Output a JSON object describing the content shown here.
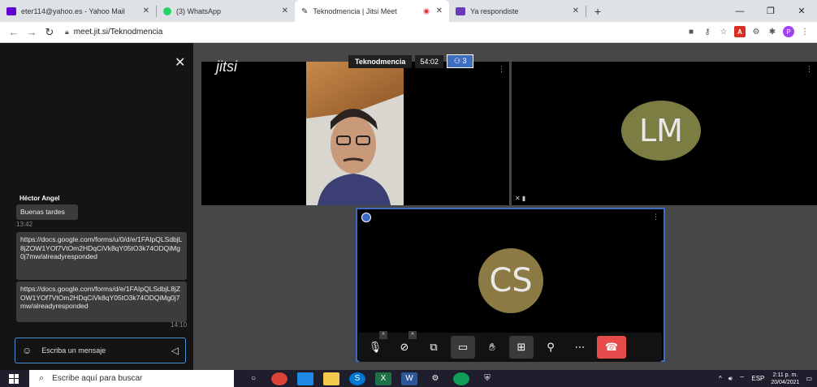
{
  "browser": {
    "tabs": [
      {
        "title": "eter114@yahoo.es - Yahoo Mail",
        "active": false
      },
      {
        "title": "(3) WhatsApp",
        "active": false
      },
      {
        "title": "Teknodmencia | Jitsi Meet",
        "active": true
      },
      {
        "title": "Ya respondiste",
        "active": false
      }
    ],
    "url": "meet.jit.si/Teknodmencia",
    "profile_initial": "P"
  },
  "chat": {
    "sender": "Héctor Angel",
    "messages": [
      {
        "text": "Buenas tardes",
        "time": "13:42"
      },
      {
        "text": "https://docs.google.com/forms/u/0/d/e/1FAIpQLSdbjL8jZOW1YOf7VtOm2HDqCiVk8qY05tO3k74ODQiMg0j7mw/alreadyresponded",
        "time": ""
      },
      {
        "text": "https://docs.google.com/forms/d/e/1FAIpQLSdbjL8jZOW1YOf7VtOm2HDqCiVk8qY05tO3k74ODQiMg0j7mw/alreadyresponded",
        "time": "14:10"
      }
    ],
    "input_placeholder": "Escriba un mensaje"
  },
  "meeting": {
    "logo": "jitsi",
    "room_name": "Teknodmencia",
    "duration": "54:02",
    "participant_count": "3",
    "participants": [
      {
        "initials": "LM",
        "avatar_color": "#7b7d43"
      },
      {
        "initials": "CS",
        "avatar_color": "#8c7a45"
      }
    ]
  },
  "taskbar": {
    "search_placeholder": "Escribe aquí para buscar",
    "language": "ESP",
    "time": "2:11 p. m.",
    "date": "20/04/2021"
  }
}
